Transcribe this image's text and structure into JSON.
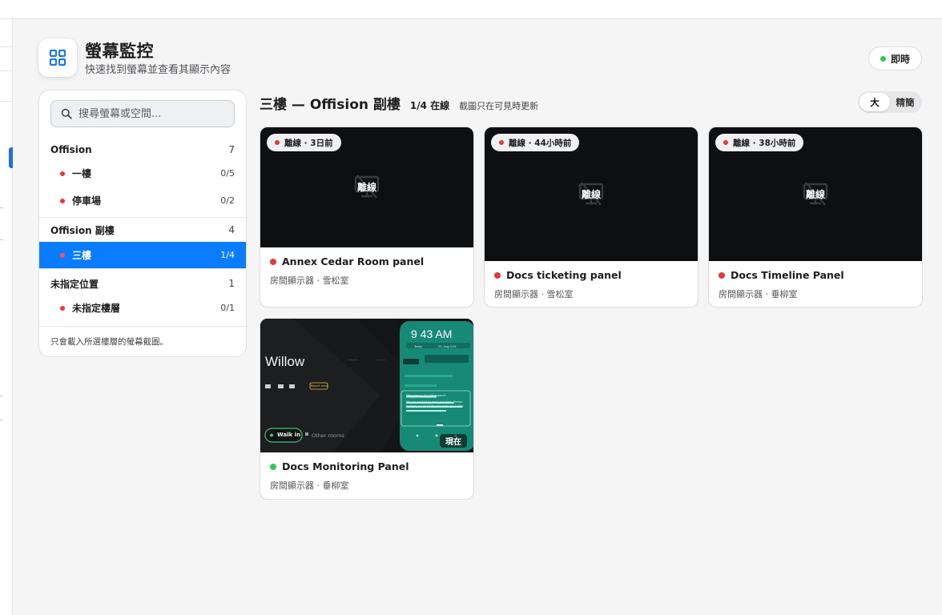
{
  "header": {
    "title": "螢幕監控",
    "subtitle": "快速找到螢幕並查看其顯示內容",
    "live_label": "即時"
  },
  "sidebar": {
    "search_placeholder": "搜尋螢幕或空間...",
    "groups": [
      {
        "name": "Offision",
        "count": "7",
        "floors": [
          {
            "name": "一樓",
            "count": "0/5"
          },
          {
            "name": "停車場",
            "count": "0/2"
          }
        ]
      },
      {
        "name": "Offision 副樓",
        "count": "4",
        "floors": [
          {
            "name": "三樓",
            "count": "1/4"
          }
        ]
      },
      {
        "name": "未指定位置",
        "count": "1",
        "floors": [
          {
            "name": "未指定樓層",
            "count": "0/1"
          }
        ]
      }
    ],
    "footer": "只會載入所選樓層的螢幕截圖。"
  },
  "section": {
    "title": "三樓 — Offision 副樓",
    "online": "1/4 在線",
    "note": "截圖只在可見時更新",
    "size_options": [
      "大",
      "精簡"
    ]
  },
  "cards": [
    {
      "status": "離線 · 3日前",
      "overlay": "離線",
      "name": "Annex Cedar Room panel",
      "sub": "房間顯示器 · 雪松室",
      "online": false
    },
    {
      "status": "離線 · 44小時前",
      "overlay": "離線",
      "name": "Docs ticketing panel",
      "sub": "房間顯示器 · 雪松室",
      "online": false
    },
    {
      "status": "離線 · 38小時前",
      "overlay": "離線",
      "name": "Docs Timeline Panel",
      "sub": "房間顯示器 · 垂柳室",
      "online": false
    },
    {
      "name": "Docs Monitoring Panel",
      "sub": "房間顯示器 · 垂柳室",
      "online": true,
      "now": "現在",
      "screenshot": {
        "brand": "Willow",
        "time": "9 43 AM",
        "report_button": "Report issue",
        "walkin": "Walk in",
        "other_rooms": "Other rooms",
        "today": "Today",
        "date": "21. Aug 2/19",
        "event_title": "Welcome to Our Workspace!",
        "event_text": "We are excited to have you here. Please explore our facilities and enjoy your stay."
      }
    }
  ],
  "colors": {
    "accent": "#0a7cff",
    "offline": "#e5383b",
    "online": "#34c759",
    "teal": "#1a8f7a"
  },
  "icons": {
    "app": "grid-icon",
    "search": "search-icon",
    "offline": "screen-off-icon"
  }
}
